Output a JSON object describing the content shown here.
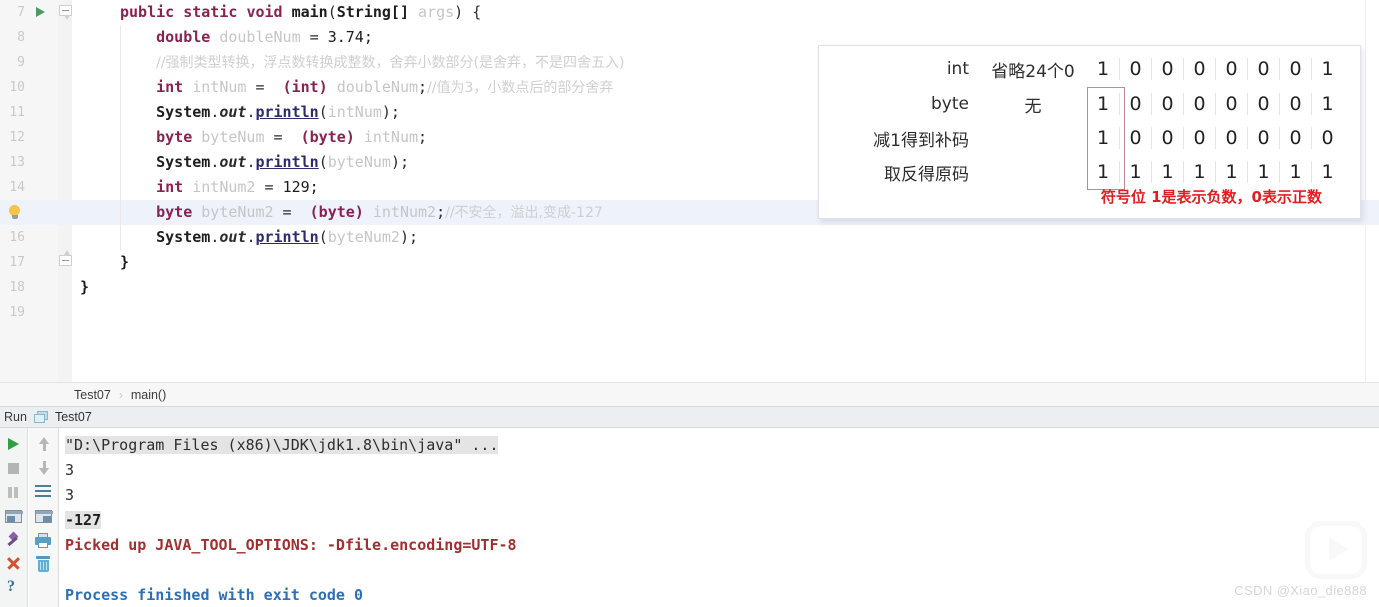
{
  "editor": {
    "first_line_number": 7,
    "current_line_number": 15,
    "lines": [
      {
        "num": "7",
        "text": "public static void main(String[] args) {"
      },
      {
        "num": "8",
        "text": "    double doubleNum = 3.74;"
      },
      {
        "num": "9",
        "text": "    //强制类型转换，浮点数转换成整数，舍弃小数部分(是舍弃，不是四舍五入)"
      },
      {
        "num": "10",
        "text": "    int intNum = (int) doubleNum;//值为3，小数点后的部分舍弃"
      },
      {
        "num": "11",
        "text": "    System.out.println(intNum);"
      },
      {
        "num": "12",
        "text": "    byte byteNum = (byte) intNum;"
      },
      {
        "num": "13",
        "text": "    System.out.println(byteNum);"
      },
      {
        "num": "14",
        "text": "    int intNum2 = 129;"
      },
      {
        "num": "15",
        "text": "    byte byteNum2 = (byte) intNum2;//不安全，溢出,变成-127"
      },
      {
        "num": "16",
        "text": "    System.out.println(byteNum2);"
      },
      {
        "num": "17",
        "text": "}"
      },
      {
        "num": "18",
        "text": "}"
      },
      {
        "num": "19",
        "text": ""
      }
    ],
    "tokens": {
      "l7": {
        "k1": "public",
        "k2": "static",
        "k3": "void",
        "name": "main",
        "p1": "(",
        "type": "String[]",
        "arg": "args",
        "p2": ") {"
      },
      "l8": {
        "kw": "double",
        "id": "doubleNum",
        "eq": " = ",
        "val": "3.74;"
      },
      "l9": {
        "comment": "//强制类型转换，浮点数转换成整数，舍弃小数部分(是舍弃，不是四舍五入)"
      },
      "l10": {
        "kw": "int",
        "id": "intNum",
        "eq": " = ",
        "cast": "(int)",
        "src": "doubleNum",
        "semi": ";",
        "comment": "//值为3，小数点后的部分舍弃"
      },
      "l11": {
        "sys": "System",
        "dot1": ".",
        "out": "out",
        "dot2": ".",
        "m": "println",
        "p1": "(",
        "arg": "intNum",
        "p2": ");"
      },
      "l12": {
        "kw": "byte",
        "id": "byteNum",
        "eq": " = ",
        "cast": "(byte)",
        "src": "intNum",
        "semi": ";"
      },
      "l13": {
        "sys": "System",
        "dot1": ".",
        "out": "out",
        "dot2": ".",
        "m": "println",
        "p1": "(",
        "arg": "byteNum",
        "p2": ");"
      },
      "l14": {
        "kw": "int",
        "id": "intNum2",
        "eq": " = ",
        "val": "129;"
      },
      "l15": {
        "kw": "byte",
        "id": "byteNum2",
        "eq": " = ",
        "cast": "(byte)",
        "src": "intNum2",
        "semi": ";",
        "comment": "//不安全，溢出,变成-127"
      },
      "l16": {
        "sys": "System",
        "dot1": ".",
        "out": "out",
        "dot2": ".",
        "m": "println",
        "p1": "(",
        "arg": "byteNum2",
        "p2": ");"
      },
      "l17": {
        "brace": "}"
      },
      "l18": {
        "brace": "}"
      }
    }
  },
  "annotation": {
    "rows": [
      {
        "label": "int",
        "note": "省略24个0",
        "bits": [
          "1",
          "0",
          "0",
          "0",
          "0",
          "0",
          "0",
          "1"
        ]
      },
      {
        "label": "byte",
        "note": "无",
        "bits": [
          "1",
          "0",
          "0",
          "0",
          "0",
          "0",
          "0",
          "1"
        ]
      },
      {
        "label": "减1得到补码",
        "note": "",
        "bits": [
          "1",
          "0",
          "0",
          "0",
          "0",
          "0",
          "0",
          "0"
        ]
      },
      {
        "label": "取反得原码",
        "note": "",
        "bits": [
          "1",
          "1",
          "1",
          "1",
          "1",
          "1",
          "1",
          "1"
        ]
      }
    ],
    "red_note": "符号位  1是表示负数，0表示正数",
    "highlight_color": "#c08a8f",
    "red_color": "#e02020"
  },
  "breadcrumb": {
    "class_name": "Test07",
    "separator": "›",
    "method_name": "main()"
  },
  "run_panel": {
    "title": "Run",
    "tab_label": "Test07",
    "toolbar_left": [
      {
        "icon": "run-icon",
        "label": "Rerun"
      },
      {
        "icon": "stop-icon",
        "label": "Stop"
      },
      {
        "icon": "pause-icon",
        "label": "Pause Output"
      },
      {
        "icon": "restore-layout-icon",
        "label": "Restore Layout"
      },
      {
        "icon": "pin-icon",
        "label": "Pin Tab"
      },
      {
        "icon": "close-icon",
        "label": "Close"
      },
      {
        "icon": "help-icon",
        "label": "Help"
      }
    ],
    "toolbar_right": [
      {
        "icon": "arrow-up-icon",
        "label": "Up the Stack Trace"
      },
      {
        "icon": "arrow-down-icon",
        "label": "Down the Stack Trace"
      },
      {
        "icon": "soft-wrap-icon",
        "label": "Soft-Wrap"
      },
      {
        "icon": "scroll-to-end-icon",
        "label": "Scroll to End"
      },
      {
        "icon": "print-icon",
        "label": "Print"
      },
      {
        "icon": "trash-icon",
        "label": "Clear All"
      }
    ],
    "console": [
      {
        "text": "\"D:\\Program Files (x86)\\JDK\\jdk1.8\\bin\\java\" ...",
        "style": "cmd",
        "highlight": true
      },
      {
        "text": "3",
        "style": "out",
        "highlight": false
      },
      {
        "text": "3",
        "style": "out",
        "highlight": false
      },
      {
        "text": "-127",
        "style": "bold",
        "highlight": true
      },
      {
        "text": "Picked up JAVA_TOOL_OPTIONS: -Dfile.encoding=UTF-8",
        "style": "err",
        "highlight": false
      },
      {
        "text": "",
        "style": "out",
        "highlight": false
      },
      {
        "text": "Process finished with exit code 0",
        "style": "info",
        "highlight": false
      }
    ]
  },
  "watermark": {
    "text": "CSDN @Xiao_die888",
    "logo": "play-button-logo"
  }
}
